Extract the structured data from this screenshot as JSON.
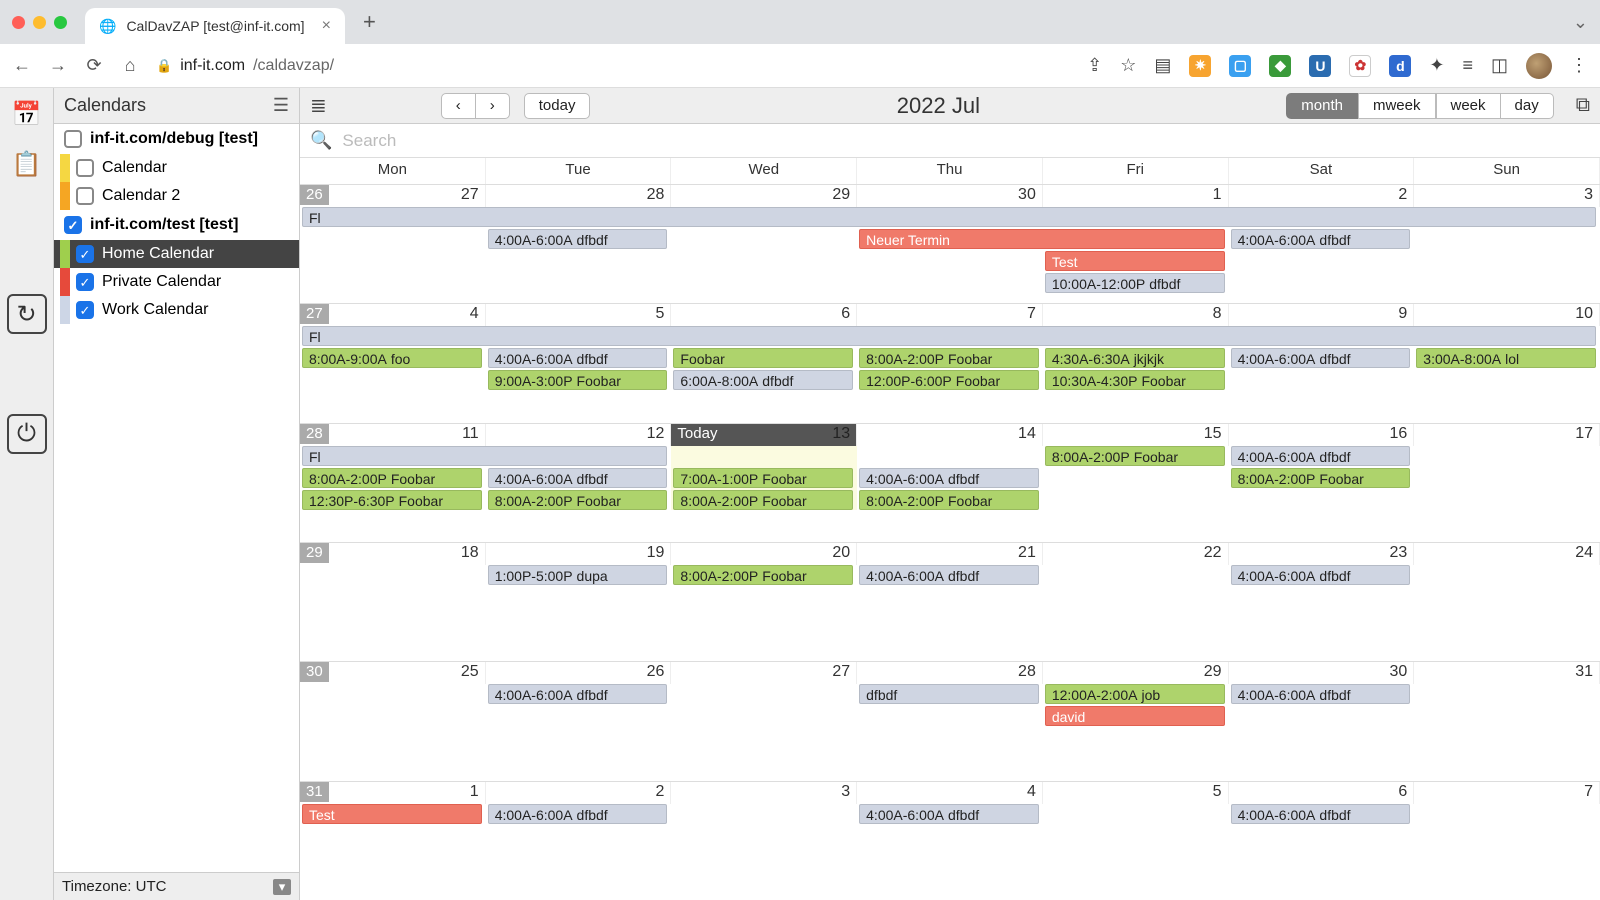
{
  "browser": {
    "tab_title": "CalDavZAP [test@inf-it.com]",
    "url_domain": "inf-it.com",
    "url_path": "/caldavzap/"
  },
  "sidebar": {
    "title": "Calendars",
    "timezone": "Timezone: UTC",
    "groups": [
      {
        "name": "inf-it.com/debug [test]",
        "checked": false,
        "items": [
          {
            "label": "Calendar",
            "swatch": "#f5d742",
            "checked": false
          },
          {
            "label": "Calendar 2",
            "swatch": "#f5a623",
            "checked": false
          }
        ]
      },
      {
        "name": "inf-it.com/test [test]",
        "checked": true,
        "items": [
          {
            "label": "Home Calendar",
            "swatch": "#9fcf4d",
            "checked": true,
            "selected": true
          },
          {
            "label": "Private Calendar",
            "swatch": "#e64a3b",
            "checked": true
          },
          {
            "label": "Work Calendar",
            "swatch": "#cdd6e6",
            "checked": true
          }
        ]
      }
    ]
  },
  "toolbar": {
    "today": "today",
    "title": "2022 Jul",
    "views": [
      "month",
      "mweek",
      "week",
      "day"
    ],
    "active_view": "month"
  },
  "search": {
    "placeholder": "Search"
  },
  "calendar": {
    "day_labels": [
      "Mon",
      "Tue",
      "Wed",
      "Thu",
      "Fri",
      "Sat",
      "Sun"
    ],
    "today_label": "Today",
    "weeks": [
      {
        "wk": 26,
        "days": [
          "27",
          "28",
          "29",
          "30",
          "1",
          "2",
          "3"
        ],
        "events": [
          {
            "row": 0,
            "start": 0,
            "span": 7,
            "color": "blue",
            "label": "Fl",
            "time": ""
          },
          {
            "row": 1,
            "start": 1,
            "span": 1,
            "color": "blue",
            "label": "dfbdf",
            "time": "4:00A-6:00A"
          },
          {
            "row": 1,
            "start": 3,
            "span": 2,
            "color": "red",
            "label": "Neuer Termin",
            "time": ""
          },
          {
            "row": 1,
            "start": 5,
            "span": 1,
            "color": "blue",
            "label": "dfbdf",
            "time": "4:00A-6:00A"
          },
          {
            "row": 2,
            "start": 4,
            "span": 1,
            "color": "red",
            "label": "Test",
            "time": ""
          },
          {
            "row": 3,
            "start": 4,
            "span": 1,
            "color": "blue",
            "label": "dfbdf",
            "time": "10:00A-12:00P"
          }
        ]
      },
      {
        "wk": 27,
        "days": [
          "4",
          "5",
          "6",
          "7",
          "8",
          "9",
          "10"
        ],
        "events": [
          {
            "row": 0,
            "start": 0,
            "span": 7,
            "color": "blue",
            "label": "Fl",
            "time": ""
          },
          {
            "row": 1,
            "start": 0,
            "span": 1,
            "color": "green",
            "label": "foo",
            "time": "8:00A-9:00A"
          },
          {
            "row": 1,
            "start": 1,
            "span": 1,
            "color": "blue",
            "label": "dfbdf",
            "time": "4:00A-6:00A"
          },
          {
            "row": 1,
            "start": 2,
            "span": 1,
            "color": "green",
            "label": "Foobar",
            "time": ""
          },
          {
            "row": 1,
            "start": 3,
            "span": 1,
            "color": "green",
            "label": "Foobar",
            "time": "8:00A-2:00P"
          },
          {
            "row": 1,
            "start": 4,
            "span": 1,
            "color": "green",
            "label": "jkjkjk",
            "time": "4:30A-6:30A"
          },
          {
            "row": 1,
            "start": 5,
            "span": 1,
            "color": "blue",
            "label": "dfbdf",
            "time": "4:00A-6:00A"
          },
          {
            "row": 1,
            "start": 6,
            "span": 1,
            "color": "green",
            "label": "lol",
            "time": "3:00A-8:00A"
          },
          {
            "row": 2,
            "start": 1,
            "span": 1,
            "color": "green",
            "label": "Foobar",
            "time": "9:00A-3:00P"
          },
          {
            "row": 2,
            "start": 2,
            "span": 1,
            "color": "blue",
            "label": "dfbdf",
            "time": "6:00A-8:00A"
          },
          {
            "row": 2,
            "start": 3,
            "span": 1,
            "color": "green",
            "label": "Foobar",
            "time": "12:00P-6:00P"
          },
          {
            "row": 2,
            "start": 4,
            "span": 1,
            "color": "green",
            "label": "Foobar",
            "time": "10:30A-4:30P"
          }
        ]
      },
      {
        "wk": 28,
        "days": [
          "11",
          "12",
          "13",
          "14",
          "15",
          "16",
          "17"
        ],
        "today_col": 2,
        "events": [
          {
            "row": 0,
            "start": 0,
            "span": 2,
            "color": "blue",
            "label": "Fl",
            "time": ""
          },
          {
            "row": 0,
            "start": 4,
            "span": 1,
            "color": "green",
            "label": "Foobar",
            "time": "8:00A-2:00P"
          },
          {
            "row": 0,
            "start": 5,
            "span": 1,
            "color": "blue",
            "label": "dfbdf",
            "time": "4:00A-6:00A"
          },
          {
            "row": 1,
            "start": 0,
            "span": 1,
            "color": "green",
            "label": "Foobar",
            "time": "8:00A-2:00P"
          },
          {
            "row": 1,
            "start": 1,
            "span": 1,
            "color": "blue",
            "label": "dfbdf",
            "time": "4:00A-6:00A"
          },
          {
            "row": 1,
            "start": 2,
            "span": 1,
            "color": "green",
            "label": "Foobar",
            "time": "7:00A-1:00P"
          },
          {
            "row": 1,
            "start": 3,
            "span": 1,
            "color": "blue",
            "label": "dfbdf",
            "time": "4:00A-6:00A"
          },
          {
            "row": 1,
            "start": 5,
            "span": 1,
            "color": "green",
            "label": "Foobar",
            "time": "8:00A-2:00P"
          },
          {
            "row": 2,
            "start": 0,
            "span": 1,
            "color": "green",
            "label": "Foobar",
            "time": "12:30P-6:30P"
          },
          {
            "row": 2,
            "start": 1,
            "span": 1,
            "color": "green",
            "label": "Foobar",
            "time": "8:00A-2:00P"
          },
          {
            "row": 2,
            "start": 2,
            "span": 1,
            "color": "green",
            "label": "Foobar",
            "time": "8:00A-2:00P"
          },
          {
            "row": 2,
            "start": 3,
            "span": 1,
            "color": "green",
            "label": "Foobar",
            "time": "8:00A-2:00P"
          }
        ]
      },
      {
        "wk": 29,
        "days": [
          "18",
          "19",
          "20",
          "21",
          "22",
          "23",
          "24"
        ],
        "events": [
          {
            "row": 0,
            "start": 1,
            "span": 1,
            "color": "blue",
            "label": "dupa",
            "time": "1:00P-5:00P"
          },
          {
            "row": 0,
            "start": 2,
            "span": 1,
            "color": "green",
            "label": "Foobar",
            "time": "8:00A-2:00P"
          },
          {
            "row": 0,
            "start": 3,
            "span": 1,
            "color": "blue",
            "label": "dfbdf",
            "time": "4:00A-6:00A"
          },
          {
            "row": 0,
            "start": 5,
            "span": 1,
            "color": "blue",
            "label": "dfbdf",
            "time": "4:00A-6:00A"
          }
        ]
      },
      {
        "wk": 30,
        "days": [
          "25",
          "26",
          "27",
          "28",
          "29",
          "30",
          "31"
        ],
        "events": [
          {
            "row": 0,
            "start": 1,
            "span": 1,
            "color": "blue",
            "label": "dfbdf",
            "time": "4:00A-6:00A"
          },
          {
            "row": 0,
            "start": 3,
            "span": 1,
            "color": "blue",
            "label": "dfbdf",
            "time": ""
          },
          {
            "row": 0,
            "start": 4,
            "span": 1,
            "color": "green",
            "label": "job",
            "time": "12:00A-2:00A"
          },
          {
            "row": 0,
            "start": 5,
            "span": 1,
            "color": "blue",
            "label": "dfbdf",
            "time": "4:00A-6:00A"
          },
          {
            "row": 1,
            "start": 4,
            "span": 1,
            "color": "red",
            "label": "david",
            "time": ""
          }
        ]
      },
      {
        "wk": 31,
        "days": [
          "1",
          "2",
          "3",
          "4",
          "5",
          "6",
          "7"
        ],
        "events": [
          {
            "row": 0,
            "start": 0,
            "span": 1,
            "color": "red",
            "label": "Test",
            "time": ""
          },
          {
            "row": 0,
            "start": 1,
            "span": 1,
            "color": "blue",
            "label": "dfbdf",
            "time": "4:00A-6:00A"
          },
          {
            "row": 0,
            "start": 3,
            "span": 1,
            "color": "blue",
            "label": "dfbdf",
            "time": "4:00A-6:00A"
          },
          {
            "row": 0,
            "start": 5,
            "span": 1,
            "color": "blue",
            "label": "dfbdf",
            "time": "4:00A-6:00A"
          }
        ]
      }
    ]
  }
}
